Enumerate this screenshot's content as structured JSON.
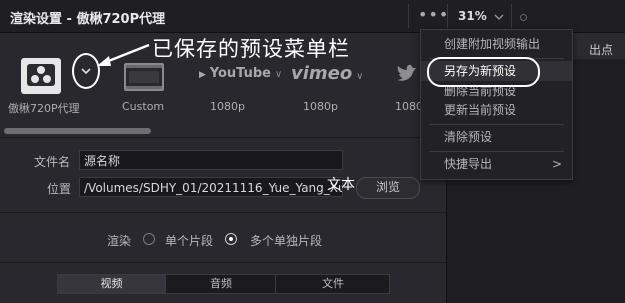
{
  "header": {
    "title": "渲染设置 - 傲楸720P代理",
    "options_icon": "more-dots-icon",
    "zoom": "31%"
  },
  "annotation": {
    "text": "已保存的预设菜单栏",
    "overlay_text": "文本"
  },
  "presets": [
    {
      "label": "傲楸720P代理",
      "icon": "custom-preset-icon"
    },
    {
      "label": "Custom",
      "icon": "film-strip-icon"
    },
    {
      "label": "1080p",
      "logo": "YouTube"
    },
    {
      "label": "1080p",
      "logo": "vimeo"
    },
    {
      "label": "1080",
      "icon": "twitter-icon"
    }
  ],
  "form": {
    "filename_label": "文件名",
    "filename_value": "源名称",
    "location_label": "位置",
    "location_value": "/Volumes/SDHY_01/20211116_Yue_Yang_Xun",
    "browse_label": "浏览"
  },
  "render": {
    "label": "渲染",
    "option_single": "单个片段",
    "option_multiple": "多个单独片段",
    "selected": "多个单独片段"
  },
  "tabs": [
    {
      "label": "视频",
      "active": true
    },
    {
      "label": "音频",
      "active": false
    },
    {
      "label": "文件",
      "active": false
    }
  ],
  "right_panel": {
    "out_point": "出点"
  },
  "menu": {
    "items": [
      {
        "label": "创建附加视频输出"
      },
      {
        "label": "另存为新预设"
      },
      {
        "label": "删除当前预设"
      },
      {
        "label": "更新当前预设"
      },
      {
        "label": "清除预设"
      },
      {
        "label": "快捷导出",
        "submenu": true
      }
    ],
    "submenu_arrow": ">"
  }
}
